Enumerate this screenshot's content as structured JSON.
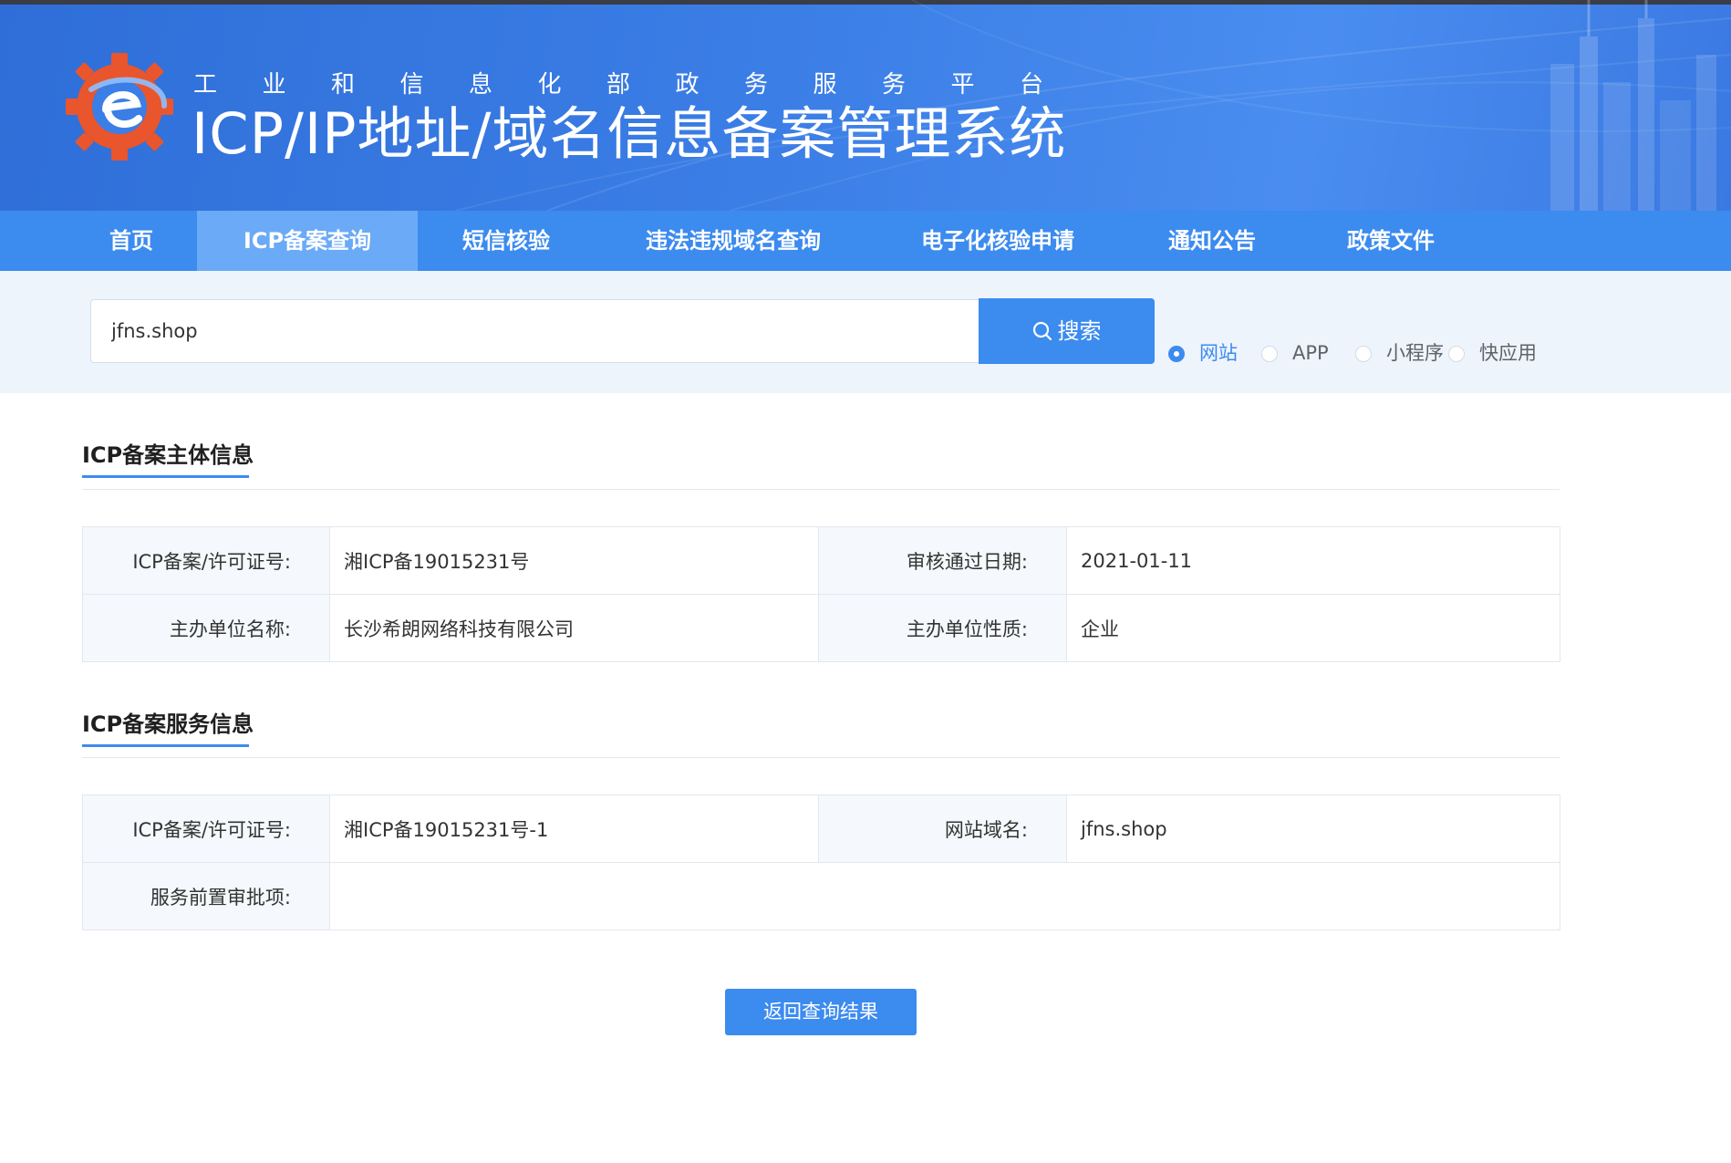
{
  "header": {
    "subtitle_chars": [
      "工",
      "业",
      "和",
      "信",
      "息",
      "化",
      "部",
      "政",
      "务",
      "服",
      "务",
      "平",
      "台"
    ],
    "title": "ICP/IP地址/域名信息备案管理系统"
  },
  "nav": {
    "items": [
      {
        "label": "首页"
      },
      {
        "label": "ICP备案查询"
      },
      {
        "label": "短信核验"
      },
      {
        "label": "违法违规域名查询"
      },
      {
        "label": "电子化核验申请"
      },
      {
        "label": "通知公告"
      },
      {
        "label": "政策文件"
      }
    ],
    "active": "ICP备案查询"
  },
  "search": {
    "value": "jfns.shop",
    "button_label": "搜索",
    "types": [
      {
        "label": "网站",
        "checked": true
      },
      {
        "label": "APP",
        "checked": false
      },
      {
        "label": "小程序",
        "checked": false
      },
      {
        "label": "快应用",
        "checked": false
      }
    ]
  },
  "entity_section": {
    "title": "ICP备案主体信息",
    "license_label": "ICP备案/许可证号:",
    "license_value": "湘ICP备19015231号",
    "approval_date_label": "审核通过日期:",
    "approval_date_value": "2021-01-11",
    "org_name_label": "主办单位名称:",
    "org_name_value": "长沙希朗网络科技有限公司",
    "org_type_label": "主办单位性质:",
    "org_type_value": "企业"
  },
  "service_section": {
    "title": "ICP备案服务信息",
    "license_label": "ICP备案/许可证号:",
    "license_value": "湘ICP备19015231号-1",
    "domain_label": "网站域名:",
    "domain_value": "jfns.shop",
    "pre_approval_label": "服务前置审批项:",
    "pre_approval_value": ""
  },
  "back_button_label": "返回查询结果",
  "colors": {
    "primary": "#3c8bef",
    "nav_active": "#6aaaf7",
    "search_band": "#eef4fc",
    "label_cell_bg": "#f5f8fc",
    "logo_orange": "#e9552c",
    "logo_blue": "#2f6ed8"
  }
}
